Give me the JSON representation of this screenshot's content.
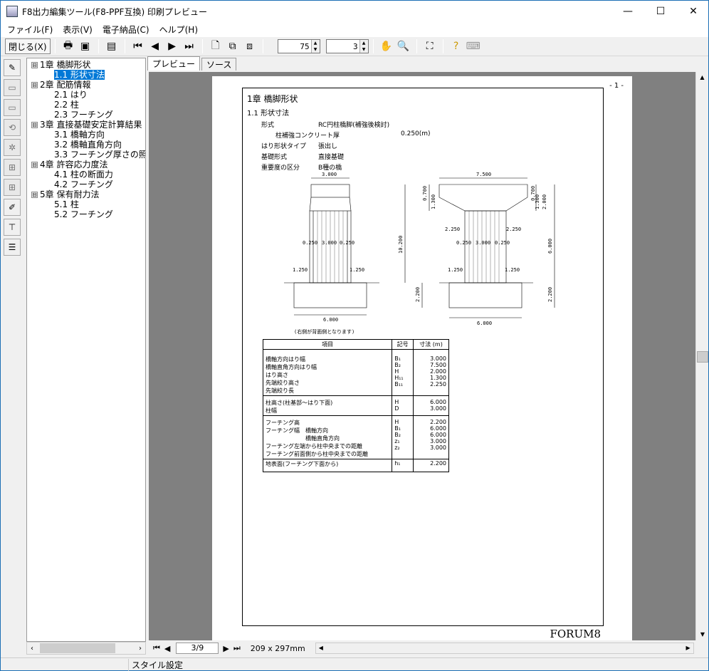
{
  "window": {
    "title": "F8出力編集ツール(F8-PPF互換) 印刷プレビュー",
    "minimize": "—",
    "maximize": "☐",
    "close": "✕"
  },
  "menu": [
    "ファイル(F)",
    "表示(V)",
    "電子納品(C)",
    "ヘルプ(H)"
  ],
  "toolbar": {
    "close_label": "閉じる(X)",
    "zoom_value": "75",
    "page_value": "3"
  },
  "tree": [
    {
      "label": "1章 橋脚形状",
      "level": 0,
      "box": "⊟"
    },
    {
      "label": "1.1 形状寸法",
      "level": 1,
      "selected": true
    },
    {
      "label": "2章 配筋情報",
      "level": 0,
      "box": "⊟"
    },
    {
      "label": "2.1 はり",
      "level": 1
    },
    {
      "label": "2.2 柱",
      "level": 1
    },
    {
      "label": "2.3 フーチング",
      "level": 1
    },
    {
      "label": "3章 直接基礎安定計算結果",
      "level": 0,
      "box": "⊟"
    },
    {
      "label": "3.1 橋軸方向",
      "level": 1
    },
    {
      "label": "3.2 橋軸直角方向",
      "level": 1
    },
    {
      "label": "3.3 フーチング厚さの照",
      "level": 1
    },
    {
      "label": "4章 許容応力度法",
      "level": 0,
      "box": "⊟"
    },
    {
      "label": "4.1 柱の断面力",
      "level": 1
    },
    {
      "label": "4.2 フーチング",
      "level": 1
    },
    {
      "label": "5章 保有耐力法",
      "level": 0,
      "box": "⊟"
    },
    {
      "label": "5.1 柱",
      "level": 1
    },
    {
      "label": "5.2 フーチング",
      "level": 1
    }
  ],
  "tabs": [
    "プレビュー",
    "ソース"
  ],
  "page": {
    "number": "- 1 -",
    "chapter": "1章 橋脚形状",
    "section": "1.1 形状寸法",
    "props": [
      {
        "k": "形式",
        "v": "RC円柱橋脚(補強後検討)"
      },
      {
        "k": "柱補強コンクリート厚",
        "v": "0.250(m)"
      },
      {
        "k": "はり形状タイプ",
        "v": "張出し"
      },
      {
        "k": "基礎形式",
        "v": "直接基礎"
      },
      {
        "k": "重要度の区分",
        "v": "B種の橋"
      }
    ],
    "dims": {
      "d3000": "3.000",
      "d7500": "7.500",
      "d10200": "10.200",
      "d6000": "6.000",
      "d2200": "2.200",
      "d0250": "0.250",
      "d1250": "1.250",
      "d2250": "2.250",
      "d0700": "0.700",
      "d1300": "1.300",
      "d2000": "2.000"
    },
    "drawing_note": "(右側が背面側となります)",
    "table_headers": [
      "項目",
      "記号",
      "寸法 (m)"
    ],
    "table_groups": [
      {
        "items": [
          "橋軸方向はり幅",
          "橋軸直角方向はり幅",
          "はり高さ",
          "先端絞り高さ",
          "先端絞り長"
        ],
        "syms": [
          "B₁",
          "B₂",
          "H",
          "H₁₁",
          "B₁₁"
        ],
        "vals": [
          "3.000",
          "7.500",
          "2.000",
          "1.300",
          "2.250"
        ]
      },
      {
        "items": [
          "柱高さ(柱基部～はり下面)",
          "柱幅"
        ],
        "syms": [
          "H",
          "D"
        ],
        "vals": [
          "6.000",
          "3.000"
        ]
      },
      {
        "items": [
          "フーチング高",
          "フーチング幅　橋軸方向",
          "　　　　　　　橋軸直角方向",
          "フーチング左端から柱中央までの距離",
          "フーチング前面側から柱中央までの距離"
        ],
        "syms": [
          "H",
          "B₁",
          "B₂",
          "z₁",
          "z₂"
        ],
        "vals": [
          "2.200",
          "6.000",
          "6.000",
          "3.000",
          "3.000"
        ]
      },
      {
        "items": [
          "地表面(フーチング下面から)"
        ],
        "syms": [
          "h₁"
        ],
        "vals": [
          "2.200"
        ]
      }
    ],
    "logo": "FORUM8"
  },
  "nav": {
    "page": "3/9",
    "size": "209 x 297mm"
  },
  "status": "スタイル設定"
}
